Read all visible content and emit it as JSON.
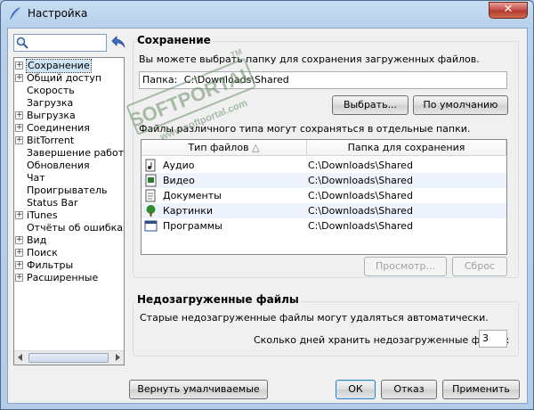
{
  "window": {
    "title": "Настройка",
    "close_label": "✕"
  },
  "sidebar": {
    "search": {
      "value": "",
      "placeholder": ""
    },
    "items": [
      {
        "label": "Сохранение",
        "expander": "+",
        "selected": true
      },
      {
        "label": "Общий доступ",
        "expander": "+"
      },
      {
        "label": "Скорость",
        "expander": ""
      },
      {
        "label": "Загрузка",
        "expander": ""
      },
      {
        "label": "Выгрузка",
        "expander": "+"
      },
      {
        "label": "Соединения",
        "expander": "+"
      },
      {
        "label": "BitTorrent",
        "expander": "+"
      },
      {
        "label": "Завершение работы",
        "expander": ""
      },
      {
        "label": "Обновления",
        "expander": ""
      },
      {
        "label": "Чат",
        "expander": ""
      },
      {
        "label": "Проигрыватель",
        "expander": ""
      },
      {
        "label": "Status Bar",
        "expander": ""
      },
      {
        "label": "iTunes",
        "expander": "+"
      },
      {
        "label": "Отчёты об ошибках",
        "expander": ""
      },
      {
        "label": "Вид",
        "expander": "+"
      },
      {
        "label": "Поиск",
        "expander": "+"
      },
      {
        "label": "Фильтры",
        "expander": "+"
      },
      {
        "label": "Расширенные",
        "expander": "+"
      }
    ]
  },
  "save_section": {
    "title": "Сохранение",
    "description": "Вы можете выбрать папку для сохранения загруженных файлов.",
    "folder_label": "Папка:",
    "folder_value": "C:\\Downloads\\Shared",
    "browse_button": "Выбрать...",
    "default_button": "По умолчанию",
    "types_note": "Файлы различного типа могут сохраняться в отдельные папки.",
    "table": {
      "columns": [
        "Тип файлов",
        "Папка для сохранения"
      ],
      "sort_indicator": "△",
      "rows": [
        {
          "type": "Аудио",
          "folder": "C:\\Downloads\\Shared",
          "icon": "audio-file-icon"
        },
        {
          "type": "Видео",
          "folder": "C:\\Downloads\\Shared",
          "icon": "video-file-icon"
        },
        {
          "type": "Документы",
          "folder": "C:\\Downloads\\Shared",
          "icon": "document-file-icon"
        },
        {
          "type": "Картинки",
          "folder": "C:\\Downloads\\Shared",
          "icon": "image-file-icon"
        },
        {
          "type": "Программы",
          "folder": "C:\\Downloads\\Shared",
          "icon": "program-file-icon"
        }
      ]
    },
    "browse_type_button": "Просмотр...",
    "reset_button": "Сброс"
  },
  "incomplete_section": {
    "title": "Недозагруженные файлы",
    "description": "Старые недозагруженные файлы могут удаляться автоматически.",
    "days_label": "Сколько дней хранить недозагруженные файлы:",
    "days_value": "3"
  },
  "footer": {
    "restore_defaults": "Вернуть умалчиваемые",
    "ok": "ОК",
    "cancel": "Отказ",
    "apply": "Применить"
  },
  "watermark": {
    "brand": "SOFTPORTAL",
    "url": "www.softportal.com",
    "tm": "TM"
  },
  "colors": {
    "selection": "#cde4f7",
    "alt_row": "#eef3fb",
    "watermark": "#6a8f6a"
  }
}
